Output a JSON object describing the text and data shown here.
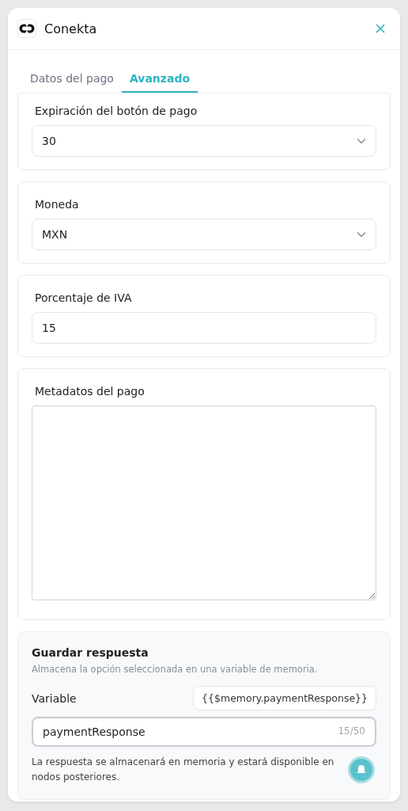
{
  "window": {
    "title": "Conekta"
  },
  "tabs": [
    {
      "label": "Datos del pago",
      "selected": false
    },
    {
      "label": "Avanzado",
      "selected": true
    }
  ],
  "sections": [
    {
      "kind": "select",
      "label": "Expiración del botón de pago",
      "value": "30"
    },
    {
      "kind": "select",
      "label": "Moneda",
      "value": "MXN"
    },
    {
      "kind": "input",
      "label": "Porcentaje de IVA",
      "value": "15"
    },
    {
      "kind": "textarea",
      "label": "Metadatos del pago"
    }
  ],
  "save_response": {
    "title": "Guardar respuesta",
    "description": "Almacena la opción seleccionada en una variable de memoria.",
    "variable_label": "Variable",
    "variable_token": "{{$memory.paymentResponse}}",
    "value": "paymentResponse",
    "counter": "15/50",
    "help": "La respuesta se almacenará en memoria y estará disponible en nodos posteriores."
  }
}
